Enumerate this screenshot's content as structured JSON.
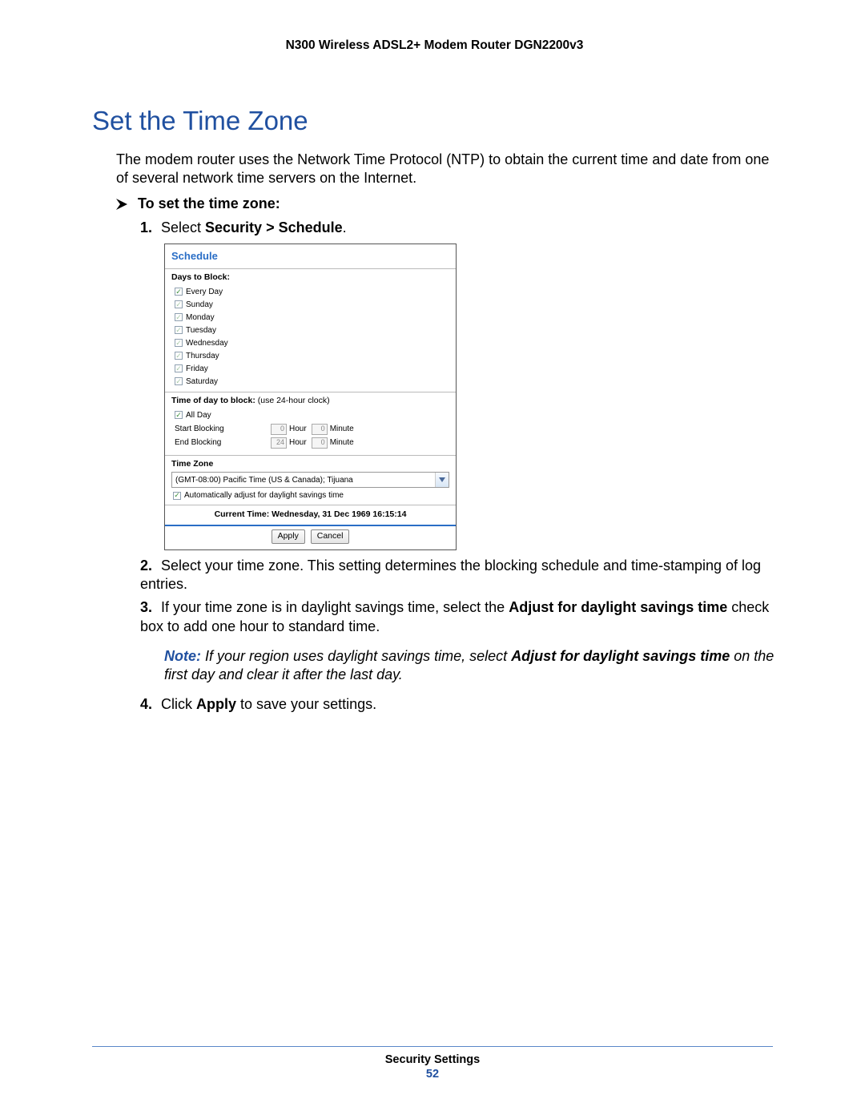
{
  "doc": {
    "header": "N300 Wireless ADSL2+ Modem Router DGN2200v3",
    "section_title": "Set the Time Zone",
    "intro": "The modem router uses the Network Time Protocol (NTP) to obtain the current time and date from one of several network time servers on the Internet.",
    "task_title": "To set the time zone:",
    "steps": {
      "s1": {
        "num": "1.",
        "pre": "Select ",
        "bold": "Security > Schedule",
        "post": "."
      },
      "s2": {
        "num": "2.",
        "text": "Select your time zone. This setting determines the blocking schedule and time-stamping of log entries."
      },
      "s3": {
        "num": "3.",
        "pre": "If your time zone is in daylight savings time, select the ",
        "bold": "Adjust for daylight savings time",
        "post": " check box to add one hour to standard time."
      },
      "s4": {
        "num": "4.",
        "pre": "Click ",
        "bold": "Apply",
        "post": " to save your settings."
      }
    },
    "note": {
      "label": "Note:",
      "pre": "  If your region uses daylight savings time, select ",
      "bold": "Adjust for daylight savings time",
      "post": " on the first day and clear it after the last day."
    },
    "footer": {
      "section": "Security Settings",
      "page": "52"
    }
  },
  "router": {
    "title": "Schedule",
    "days_label": "Days to Block:",
    "days": [
      {
        "label": "Every Day",
        "checked": true,
        "dim": false
      },
      {
        "label": "Sunday",
        "checked": true,
        "dim": true
      },
      {
        "label": "Monday",
        "checked": true,
        "dim": true
      },
      {
        "label": "Tuesday",
        "checked": true,
        "dim": true
      },
      {
        "label": "Wednesday",
        "checked": true,
        "dim": true
      },
      {
        "label": "Thursday",
        "checked": true,
        "dim": true
      },
      {
        "label": "Friday",
        "checked": true,
        "dim": true
      },
      {
        "label": "Saturday",
        "checked": true,
        "dim": true
      }
    ],
    "tod_label": "Time of day to block:",
    "tod_hint": " (use 24-hour clock)",
    "all_day_label": "All Day",
    "start_label": "Start Blocking",
    "end_label": "End Blocking",
    "hour_unit": "Hour",
    "minute_unit": "Minute",
    "start_hour": "0",
    "start_min": "0",
    "end_hour": "24",
    "end_min": "0",
    "tz_section_label": "Time Zone",
    "tz_value": "(GMT-08:00) Pacific Time (US & Canada); Tijuana",
    "dst_label": "Automatically adjust for daylight savings time",
    "current_time": "Current Time: Wednesday, 31 Dec 1969 16:15:14",
    "apply": "Apply",
    "cancel": "Cancel"
  }
}
